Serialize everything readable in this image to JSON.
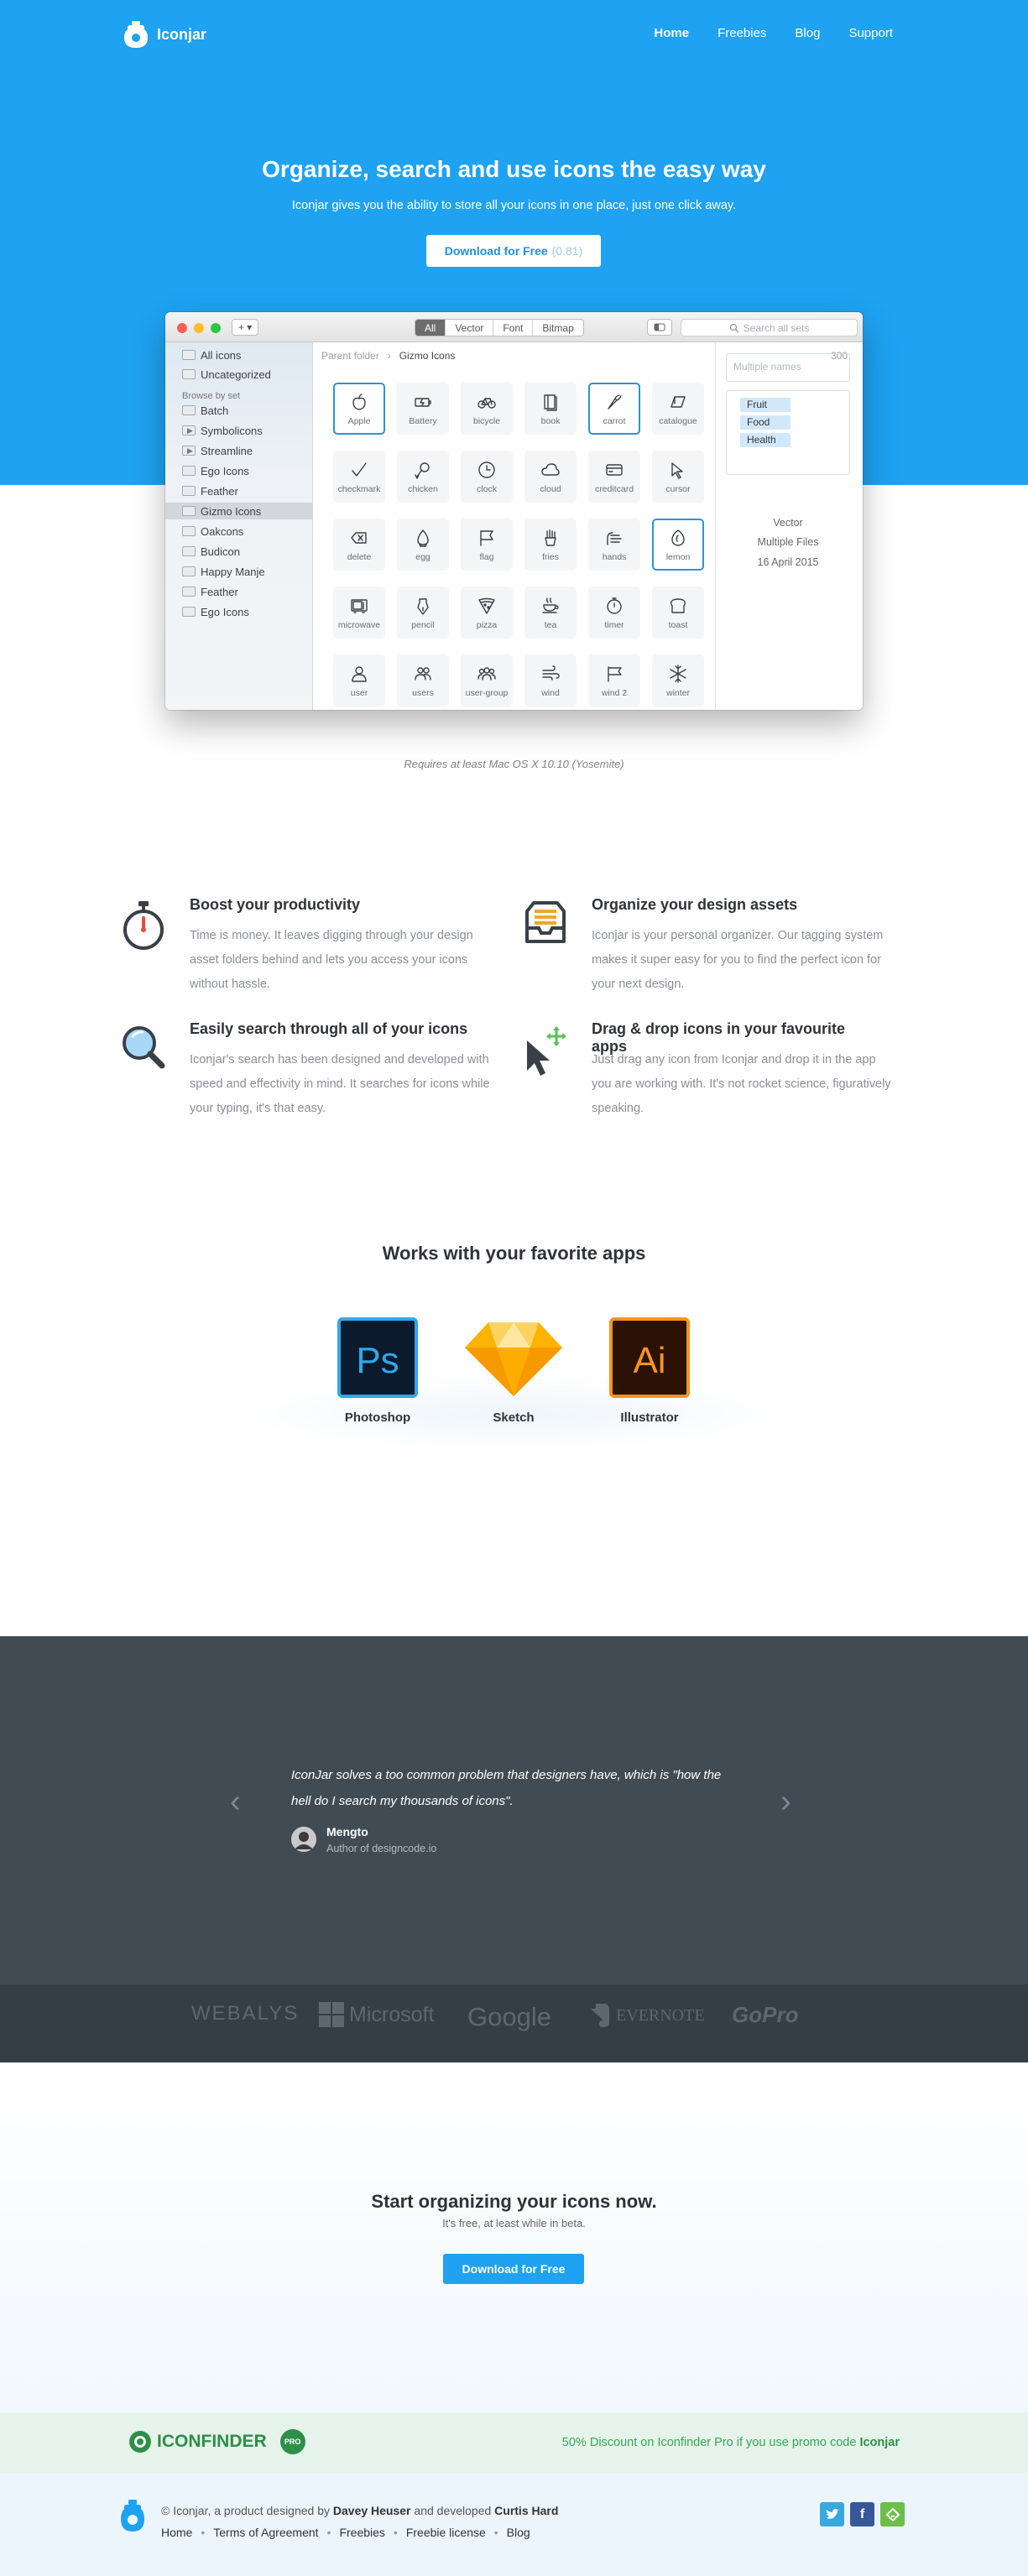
{
  "nav": {
    "brand": "Iconjar",
    "links": [
      "Home",
      "Freebies",
      "Blog",
      "Support"
    ],
    "active": "Home"
  },
  "hero": {
    "title": "Organize, search and use icons the easy way",
    "subtitle": "Iconjar gives you the ability to store all your icons in one place, just one click away.",
    "button_label": "Download for Free",
    "button_version": "(0.81)"
  },
  "app": {
    "add_label": "+ ▾",
    "filters": [
      "All",
      "Vector",
      "Font",
      "Bitmap"
    ],
    "active_filter": "All",
    "search_placeholder": "Search all sets",
    "sidebar": {
      "top": [
        "All icons",
        "Uncategorized"
      ],
      "header": "Browse by set",
      "sets": [
        "Batch",
        "Symbolicons",
        "Streamline",
        "Ego Icons",
        "Feather",
        "Gizmo Icons",
        "Oakcons",
        "Budicon",
        "Happy Manje",
        "Feather",
        "Ego Icons"
      ],
      "selected": "Gizmo Icons"
    },
    "breadcrumb": {
      "parent": "Parent folder",
      "current": "Gizmo Icons",
      "count": "300"
    },
    "icons": [
      "Apple",
      "Battery",
      "bicycle",
      "book",
      "carrot",
      "catalogue",
      "checkmark",
      "chicken",
      "clock",
      "cloud",
      "creditcard",
      "cursor",
      "delete",
      "egg",
      "flag",
      "fries",
      "hands",
      "lemon",
      "microwave",
      "pencil",
      "pizza",
      "tea",
      "timer",
      "toast",
      "user",
      "users",
      "user-group",
      "wind",
      "wind 2",
      "winter"
    ],
    "selected_icons": [
      "Apple",
      "carrot",
      "lemon"
    ],
    "info": {
      "names_placeholder": "Multiple names",
      "tags": [
        "Fruit",
        "Food",
        "Health"
      ],
      "type": "Vector",
      "files": "Multiple Files",
      "date": "16 April 2015"
    }
  },
  "requirement": "Requires at least Mac OS X 10.10 (Yosemite)",
  "features": [
    {
      "icon": "stopwatch-icon",
      "title": "Boost your productivity",
      "text": "Time is money. It leaves digging through your design asset folders behind and lets you access your icons without hassle."
    },
    {
      "icon": "inbox-tray-icon",
      "title": "Organize your design assets",
      "text": "Iconjar is your personal organizer. Our tagging system makes it super easy for you to find the perfect icon for your next design."
    },
    {
      "icon": "magnifier-icon",
      "title": "Easily search through all of your icons",
      "text": "Iconjar's search has been designed and developed with speed and effectivity in mind. It searches for icons while your typing, it's that easy."
    },
    {
      "icon": "drag-cursor-icon",
      "title": "Drag & drop icons in your favourite apps",
      "text": "Just drag any icon from Iconjar and drop it in the app you are working with. It's not rocket science, figuratively speaking."
    }
  ],
  "apps": {
    "title": "Works with your favorite apps",
    "items": [
      {
        "name": "Photoshop",
        "abbr": "Ps"
      },
      {
        "name": "Sketch",
        "abbr": ""
      },
      {
        "name": "Illustrator",
        "abbr": "Ai"
      }
    ]
  },
  "testimonial": {
    "quote": "IconJar solves a too common problem that designers have, which is \"how the hell do I search my thousands of icons\".",
    "name": "Mengto",
    "role": "Author of designcode.io"
  },
  "brands": [
    "WEBALYS",
    "Microsoft",
    "Google",
    "EVERNOTE",
    "GoPro"
  ],
  "cta": {
    "title": "Start organizing your icons now.",
    "subtitle": "It's free, at least while in beta.",
    "button": "Download for Free"
  },
  "promo": {
    "logo": "ICONFINDER",
    "badge": "PRO",
    "text": "50% Discount on Iconfinder Pro if you use promo code ",
    "code": "Iconjar"
  },
  "footer": {
    "copy_prefix": "© Iconjar, a product designed by ",
    "designer": "Davey Heuser",
    "middle": " and developed ",
    "developer": "Curtis Hard",
    "links": [
      "Home",
      "Terms of Agreement",
      "Freebies",
      "Freebie license",
      "Blog"
    ],
    "social": [
      "twitter",
      "facebook",
      "feedly"
    ]
  },
  "colors": {
    "brand_blue": "#1ea2f1",
    "dark": "#414b53",
    "green": "#35a855"
  }
}
